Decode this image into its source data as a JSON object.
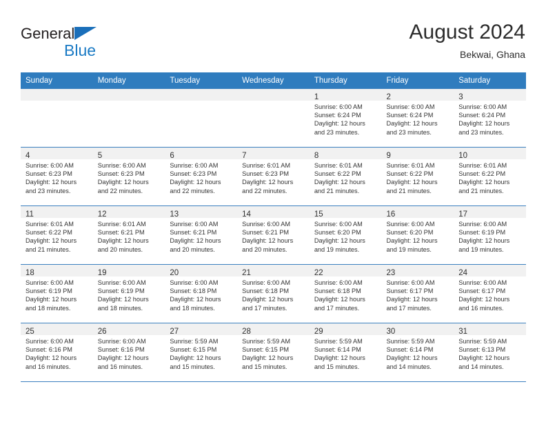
{
  "brand": {
    "name_primary": "General",
    "name_secondary": "Blue",
    "flag_icon": "triangle-flag-icon",
    "accent_color": "#1a7ac4"
  },
  "header": {
    "title": "August 2024",
    "subtitle": "Bekwai, Ghana"
  },
  "calendar": {
    "header_bg": "#2f7cbe",
    "daynum_bg": "#f1f1f1",
    "weekdays": [
      "Sunday",
      "Monday",
      "Tuesday",
      "Wednesday",
      "Thursday",
      "Friday",
      "Saturday"
    ],
    "weeks": [
      [
        {
          "day": "",
          "lines": []
        },
        {
          "day": "",
          "lines": []
        },
        {
          "day": "",
          "lines": []
        },
        {
          "day": "",
          "lines": []
        },
        {
          "day": "1",
          "lines": [
            "Sunrise: 6:00 AM",
            "Sunset: 6:24 PM",
            "Daylight: 12 hours",
            "and 23 minutes."
          ]
        },
        {
          "day": "2",
          "lines": [
            "Sunrise: 6:00 AM",
            "Sunset: 6:24 PM",
            "Daylight: 12 hours",
            "and 23 minutes."
          ]
        },
        {
          "day": "3",
          "lines": [
            "Sunrise: 6:00 AM",
            "Sunset: 6:24 PM",
            "Daylight: 12 hours",
            "and 23 minutes."
          ]
        }
      ],
      [
        {
          "day": "4",
          "lines": [
            "Sunrise: 6:00 AM",
            "Sunset: 6:23 PM",
            "Daylight: 12 hours",
            "and 23 minutes."
          ]
        },
        {
          "day": "5",
          "lines": [
            "Sunrise: 6:00 AM",
            "Sunset: 6:23 PM",
            "Daylight: 12 hours",
            "and 22 minutes."
          ]
        },
        {
          "day": "6",
          "lines": [
            "Sunrise: 6:00 AM",
            "Sunset: 6:23 PM",
            "Daylight: 12 hours",
            "and 22 minutes."
          ]
        },
        {
          "day": "7",
          "lines": [
            "Sunrise: 6:01 AM",
            "Sunset: 6:23 PM",
            "Daylight: 12 hours",
            "and 22 minutes."
          ]
        },
        {
          "day": "8",
          "lines": [
            "Sunrise: 6:01 AM",
            "Sunset: 6:22 PM",
            "Daylight: 12 hours",
            "and 21 minutes."
          ]
        },
        {
          "day": "9",
          "lines": [
            "Sunrise: 6:01 AM",
            "Sunset: 6:22 PM",
            "Daylight: 12 hours",
            "and 21 minutes."
          ]
        },
        {
          "day": "10",
          "lines": [
            "Sunrise: 6:01 AM",
            "Sunset: 6:22 PM",
            "Daylight: 12 hours",
            "and 21 minutes."
          ]
        }
      ],
      [
        {
          "day": "11",
          "lines": [
            "Sunrise: 6:01 AM",
            "Sunset: 6:22 PM",
            "Daylight: 12 hours",
            "and 21 minutes."
          ]
        },
        {
          "day": "12",
          "lines": [
            "Sunrise: 6:01 AM",
            "Sunset: 6:21 PM",
            "Daylight: 12 hours",
            "and 20 minutes."
          ]
        },
        {
          "day": "13",
          "lines": [
            "Sunrise: 6:00 AM",
            "Sunset: 6:21 PM",
            "Daylight: 12 hours",
            "and 20 minutes."
          ]
        },
        {
          "day": "14",
          "lines": [
            "Sunrise: 6:00 AM",
            "Sunset: 6:21 PM",
            "Daylight: 12 hours",
            "and 20 minutes."
          ]
        },
        {
          "day": "15",
          "lines": [
            "Sunrise: 6:00 AM",
            "Sunset: 6:20 PM",
            "Daylight: 12 hours",
            "and 19 minutes."
          ]
        },
        {
          "day": "16",
          "lines": [
            "Sunrise: 6:00 AM",
            "Sunset: 6:20 PM",
            "Daylight: 12 hours",
            "and 19 minutes."
          ]
        },
        {
          "day": "17",
          "lines": [
            "Sunrise: 6:00 AM",
            "Sunset: 6:19 PM",
            "Daylight: 12 hours",
            "and 19 minutes."
          ]
        }
      ],
      [
        {
          "day": "18",
          "lines": [
            "Sunrise: 6:00 AM",
            "Sunset: 6:19 PM",
            "Daylight: 12 hours",
            "and 18 minutes."
          ]
        },
        {
          "day": "19",
          "lines": [
            "Sunrise: 6:00 AM",
            "Sunset: 6:19 PM",
            "Daylight: 12 hours",
            "and 18 minutes."
          ]
        },
        {
          "day": "20",
          "lines": [
            "Sunrise: 6:00 AM",
            "Sunset: 6:18 PM",
            "Daylight: 12 hours",
            "and 18 minutes."
          ]
        },
        {
          "day": "21",
          "lines": [
            "Sunrise: 6:00 AM",
            "Sunset: 6:18 PM",
            "Daylight: 12 hours",
            "and 17 minutes."
          ]
        },
        {
          "day": "22",
          "lines": [
            "Sunrise: 6:00 AM",
            "Sunset: 6:18 PM",
            "Daylight: 12 hours",
            "and 17 minutes."
          ]
        },
        {
          "day": "23",
          "lines": [
            "Sunrise: 6:00 AM",
            "Sunset: 6:17 PM",
            "Daylight: 12 hours",
            "and 17 minutes."
          ]
        },
        {
          "day": "24",
          "lines": [
            "Sunrise: 6:00 AM",
            "Sunset: 6:17 PM",
            "Daylight: 12 hours",
            "and 16 minutes."
          ]
        }
      ],
      [
        {
          "day": "25",
          "lines": [
            "Sunrise: 6:00 AM",
            "Sunset: 6:16 PM",
            "Daylight: 12 hours",
            "and 16 minutes."
          ]
        },
        {
          "day": "26",
          "lines": [
            "Sunrise: 6:00 AM",
            "Sunset: 6:16 PM",
            "Daylight: 12 hours",
            "and 16 minutes."
          ]
        },
        {
          "day": "27",
          "lines": [
            "Sunrise: 5:59 AM",
            "Sunset: 6:15 PM",
            "Daylight: 12 hours",
            "and 15 minutes."
          ]
        },
        {
          "day": "28",
          "lines": [
            "Sunrise: 5:59 AM",
            "Sunset: 6:15 PM",
            "Daylight: 12 hours",
            "and 15 minutes."
          ]
        },
        {
          "day": "29",
          "lines": [
            "Sunrise: 5:59 AM",
            "Sunset: 6:14 PM",
            "Daylight: 12 hours",
            "and 15 minutes."
          ]
        },
        {
          "day": "30",
          "lines": [
            "Sunrise: 5:59 AM",
            "Sunset: 6:14 PM",
            "Daylight: 12 hours",
            "and 14 minutes."
          ]
        },
        {
          "day": "31",
          "lines": [
            "Sunrise: 5:59 AM",
            "Sunset: 6:13 PM",
            "Daylight: 12 hours",
            "and 14 minutes."
          ]
        }
      ]
    ]
  }
}
